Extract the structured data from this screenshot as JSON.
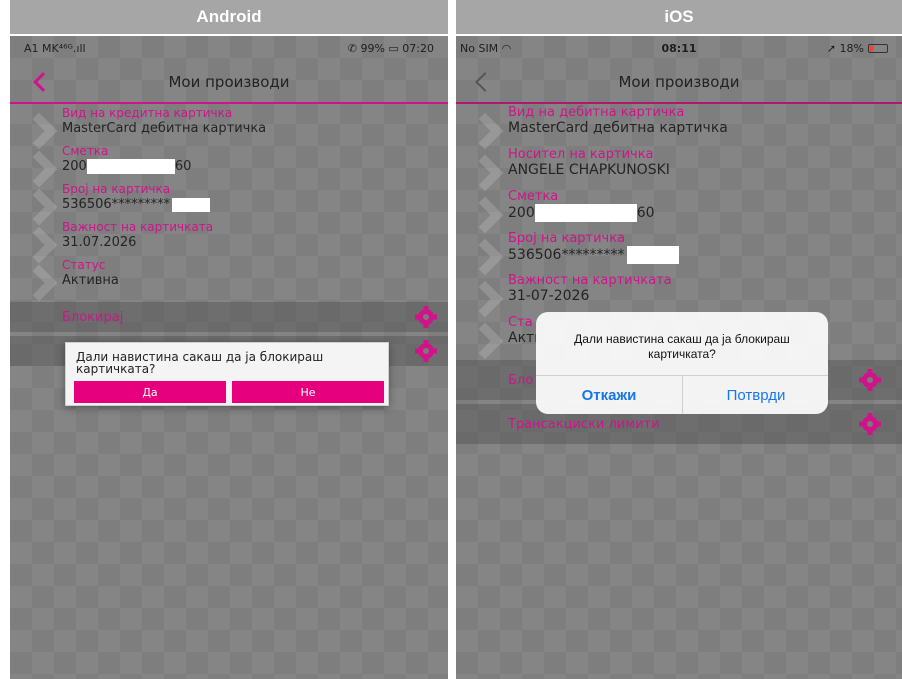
{
  "labels": {
    "android": "Android",
    "ios": "iOS"
  },
  "colors": {
    "accent": "#e6007e",
    "ios_link": "#1877e8",
    "battery_low": "#ff3b30"
  },
  "android": {
    "status": {
      "carrier": "A1 MK⁴⁶ᴳ.ıll",
      "right": "✆ 99% ▭ 07:20"
    },
    "title": "Мои производи",
    "fields": [
      {
        "label": "Вид на кредитна картичка",
        "value": "MasterCard дебитна картичка"
      },
      {
        "label": "Сметка",
        "prefix": "200",
        "suffix": "60"
      },
      {
        "label": "Број на картичка",
        "prefix": "536506*********"
      },
      {
        "label": "Важност на картичката",
        "value": "31.07.2026"
      },
      {
        "label": "Статус",
        "value": "Активна"
      }
    ],
    "actions": [
      {
        "label": "Блокирај"
      },
      {
        "label": ""
      }
    ],
    "dialog": {
      "message": "Дали навистина сакаш да ја блокираш картичката?",
      "yes": "Да",
      "no": "Не"
    }
  },
  "ios": {
    "status": {
      "carrier": "No SIM ◠",
      "time": "08:11",
      "battery": "➚ 18%"
    },
    "title": "Мои производи",
    "fields": [
      {
        "label": "Вид на дебитна картичка",
        "value": "MasterCard дебитна картичка"
      },
      {
        "label": "Носител на картичка",
        "value": "ANGELE CHAPKUNOSKI"
      },
      {
        "label": "Сметка",
        "prefix": "200",
        "suffix": "60"
      },
      {
        "label": "Број на картичка",
        "prefix": "536506*********"
      },
      {
        "label": "Важност на картичката",
        "value": "31-07-2026"
      },
      {
        "label": "Ста",
        "value": "Акти"
      }
    ],
    "actions": [
      {
        "label": "Бло"
      },
      {
        "label": "Трансакциски лимити"
      }
    ],
    "dialog": {
      "message": "Дали навистина сакаш да ја блокираш картичката?",
      "cancel": "Откажи",
      "confirm": "Потврди"
    }
  }
}
